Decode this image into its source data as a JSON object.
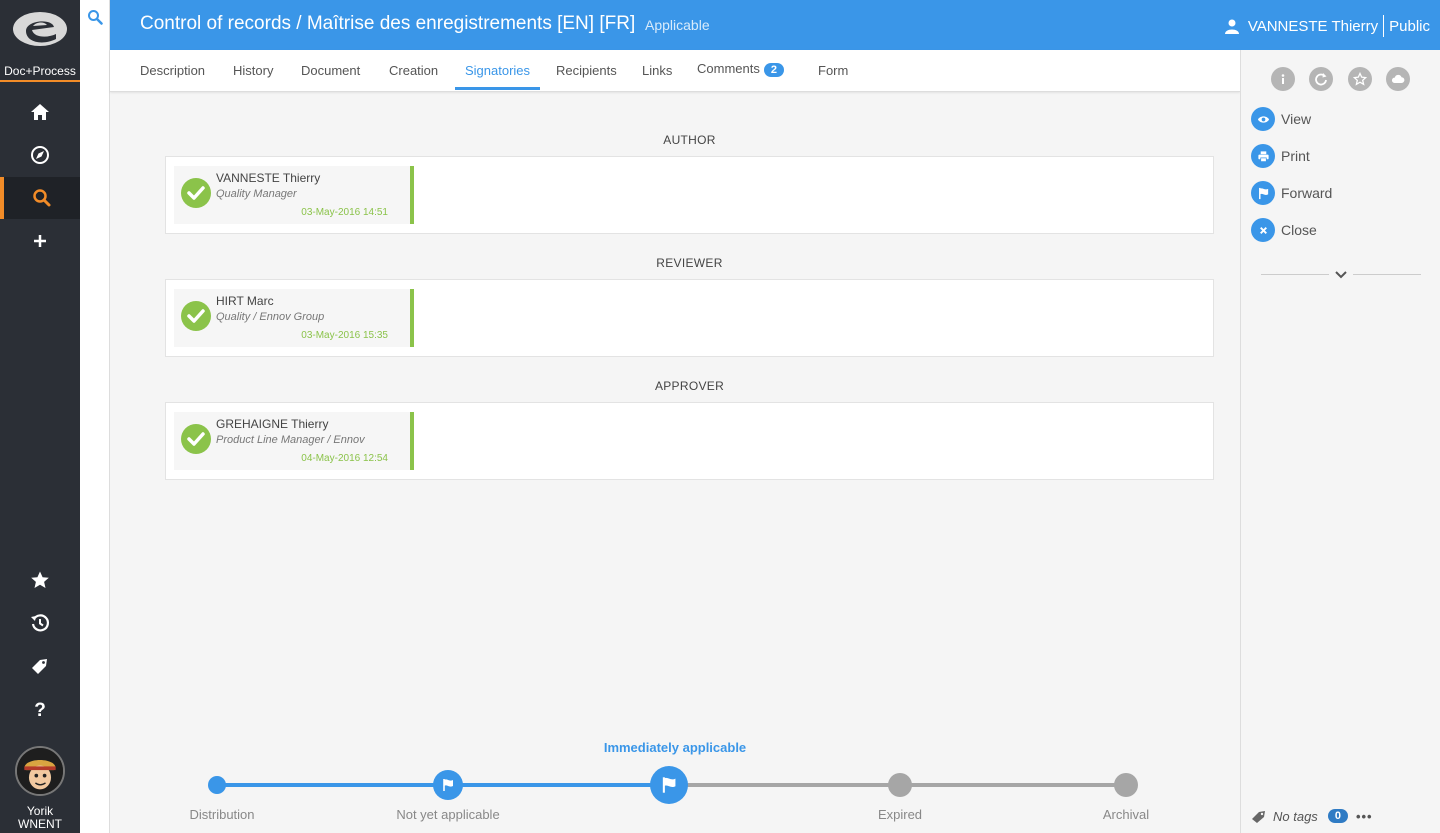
{
  "app": {
    "logo_text": "Doc+Process",
    "user_first": "Yorik",
    "user_last": "WNENT"
  },
  "header": {
    "title": "Control of records / Maîtrise des enregistrements [EN] [FR]",
    "status": "Applicable",
    "user": "VANNESTE Thierry",
    "visibility": "Public"
  },
  "tabs": [
    {
      "label": "Description"
    },
    {
      "label": "History"
    },
    {
      "label": "Document"
    },
    {
      "label": "Creation"
    },
    {
      "label": "Signatories"
    },
    {
      "label": "Recipients"
    },
    {
      "label": "Links"
    },
    {
      "label": "Comments",
      "badge": "2"
    },
    {
      "label": "Form"
    }
  ],
  "active_tab": "Signatories",
  "sections": [
    {
      "label": "AUTHOR",
      "signer": {
        "name": "VANNESTE Thierry",
        "role": "Quality Manager",
        "date": "03-May-2016 14:51"
      }
    },
    {
      "label": "REVIEWER",
      "signer": {
        "name": "HIRT Marc",
        "role": "Quality / Ennov Group",
        "date": "03-May-2016 15:35"
      }
    },
    {
      "label": "APPROVER",
      "signer": {
        "name": "GREHAIGNE Thierry",
        "role": "Product Line Manager / Ennov",
        "date": "04-May-2016 12:54"
      }
    }
  ],
  "timeline": {
    "current": "Immediately applicable",
    "steps": [
      {
        "label": "Distribution"
      },
      {
        "label": "Not yet applicable"
      },
      {
        "label": "Immediately applicable"
      },
      {
        "label": "Expired"
      },
      {
        "label": "Archival"
      }
    ]
  },
  "actions": [
    {
      "label": "View",
      "icon": "eye-icon"
    },
    {
      "label": "Print",
      "icon": "printer-icon"
    },
    {
      "label": "Forward",
      "icon": "flag-icon"
    },
    {
      "label": "Close",
      "icon": "close-icon"
    }
  ],
  "tags": {
    "label": "No tags",
    "count": "0",
    "more": "•••"
  },
  "colors": {
    "accent": "#3a96e8",
    "success": "#8bc34a",
    "sidebar": "#2b2f36",
    "highlight": "#f28c28"
  }
}
